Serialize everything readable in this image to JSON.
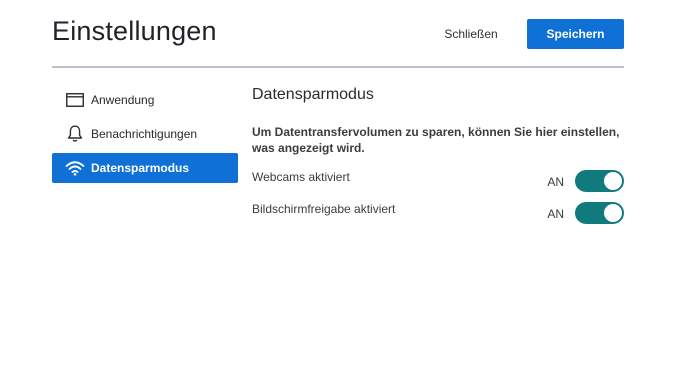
{
  "header": {
    "title": "Einstellungen",
    "close_label": "Schließen",
    "save_label": "Speichern"
  },
  "sidebar": {
    "items": [
      {
        "label": "Anwendung",
        "icon": "window-icon",
        "active": false
      },
      {
        "label": "Benachrichtigungen",
        "icon": "bell-icon",
        "active": false
      },
      {
        "label": "Datensparmodus",
        "icon": "wifi-icon",
        "active": true
      }
    ]
  },
  "main": {
    "title": "Datensparmodus",
    "description": "Um Datentransfervolumen zu sparen, können Sie hier einstellen, was angezeigt wird.",
    "settings": [
      {
        "label": "Webcams aktiviert",
        "state": "AN",
        "enabled": true
      },
      {
        "label": "Bildschirmfreigabe aktiviert",
        "state": "AN",
        "enabled": true
      }
    ]
  },
  "colors": {
    "accent": "#0f71d6",
    "toggle_on": "#107a7d",
    "divider": "#b9c2cc"
  }
}
